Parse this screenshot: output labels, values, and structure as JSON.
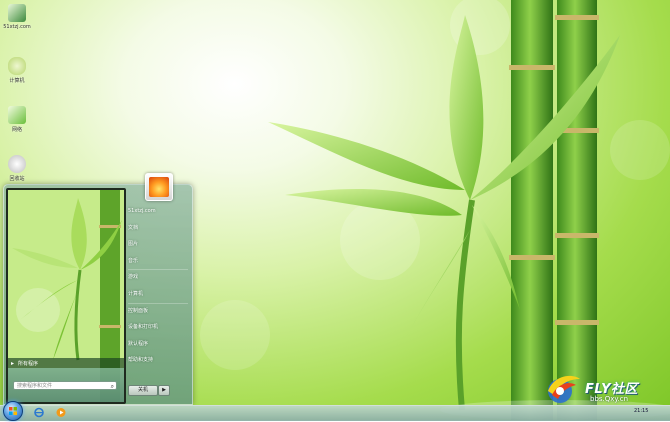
{
  "desktop": {
    "icons": [
      {
        "label": "51xtzj.com",
        "icon": "computer-icon",
        "color": "#3c8a3c"
      },
      {
        "label": "计算机",
        "icon": "computer-icon",
        "color": "#b5d56a"
      },
      {
        "label": "网络",
        "icon": "network-icon",
        "color": "#6abf3b"
      },
      {
        "label": "回收站",
        "icon": "recycle-bin-icon",
        "color": "#d8d8d8"
      }
    ]
  },
  "start_menu": {
    "all_programs_label": "所有程序",
    "search_placeholder": "搜索程序和文件",
    "right_items": [
      "51xtzj.com",
      "文档",
      "图片",
      "音乐",
      "游戏",
      "计算机",
      "控制面板",
      "设备和打印机",
      "默认程序",
      "帮助和支持"
    ],
    "shutdown_label": "关机",
    "shutdown_arrow": "▶"
  },
  "taskbar": {
    "clock": "21:15"
  },
  "watermark": {
    "brand": "FLY社区",
    "url": "bbs.Qxy.cn"
  },
  "colors": {
    "accent_green": "#7dc627",
    "taskbar": "#b4cfc5"
  }
}
